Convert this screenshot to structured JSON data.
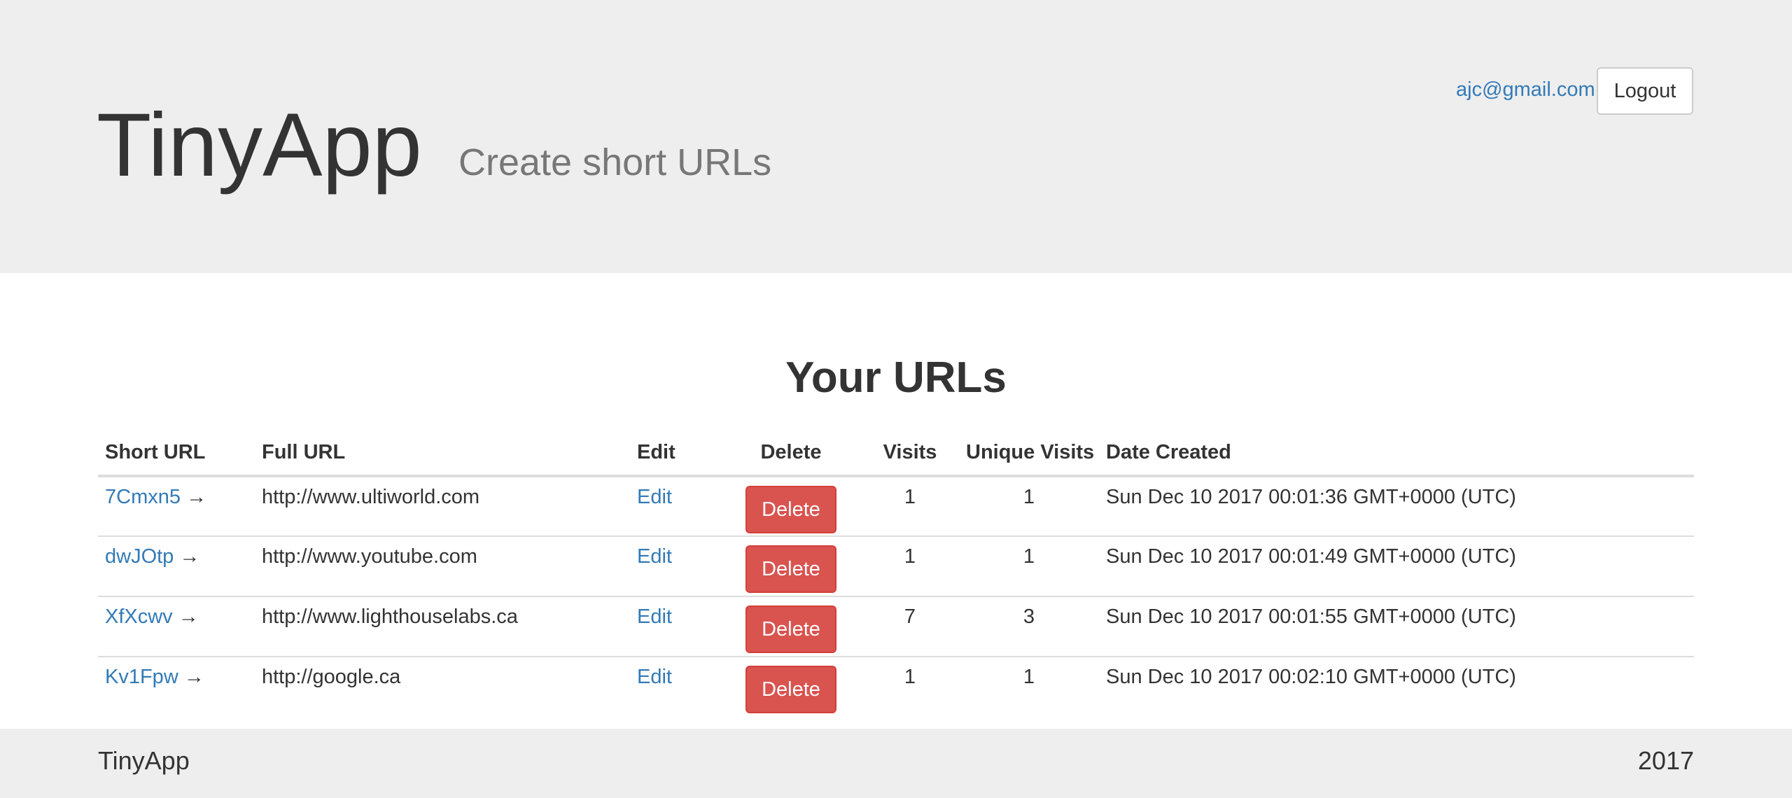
{
  "header": {
    "title": "TinyApp",
    "tagline": "Create short URLs",
    "user_email": "ajc@gmail.com",
    "logout_label": "Logout"
  },
  "main": {
    "heading": "Your URLs",
    "columns": [
      "Short URL",
      "Full URL",
      "Edit",
      "Delete",
      "Visits",
      "Unique Visits",
      "Date Created"
    ],
    "arrow": "→",
    "rows": [
      {
        "short": "7Cmxn5",
        "full": "http://www.ultiworld.com",
        "edit": "Edit",
        "delete": "Delete",
        "visits": "1",
        "unique": "1",
        "created": "Sun Dec 10 2017 00:01:36 GMT+0000 (UTC)"
      },
      {
        "short": "dwJOtp",
        "full": "http://www.youtube.com",
        "edit": "Edit",
        "delete": "Delete",
        "visits": "1",
        "unique": "1",
        "created": "Sun Dec 10 2017 00:01:49 GMT+0000 (UTC)"
      },
      {
        "short": "XfXcwv",
        "full": "http://www.lighthouselabs.ca",
        "edit": "Edit",
        "delete": "Delete",
        "visits": "7",
        "unique": "3",
        "created": "Sun Dec 10 2017 00:01:55 GMT+0000 (UTC)"
      },
      {
        "short": "Kv1Fpw",
        "full": "http://google.ca",
        "edit": "Edit",
        "delete": "Delete",
        "visits": "1",
        "unique": "1",
        "created": "Sun Dec 10 2017 00:02:10 GMT+0000 (UTC)"
      }
    ]
  },
  "footer": {
    "brand": "TinyApp",
    "year": "2017"
  },
  "colors": {
    "header_bg": "#eeeeee",
    "link": "#337ab7",
    "danger": "#d9534f",
    "text": "#333333",
    "muted": "#777777"
  }
}
